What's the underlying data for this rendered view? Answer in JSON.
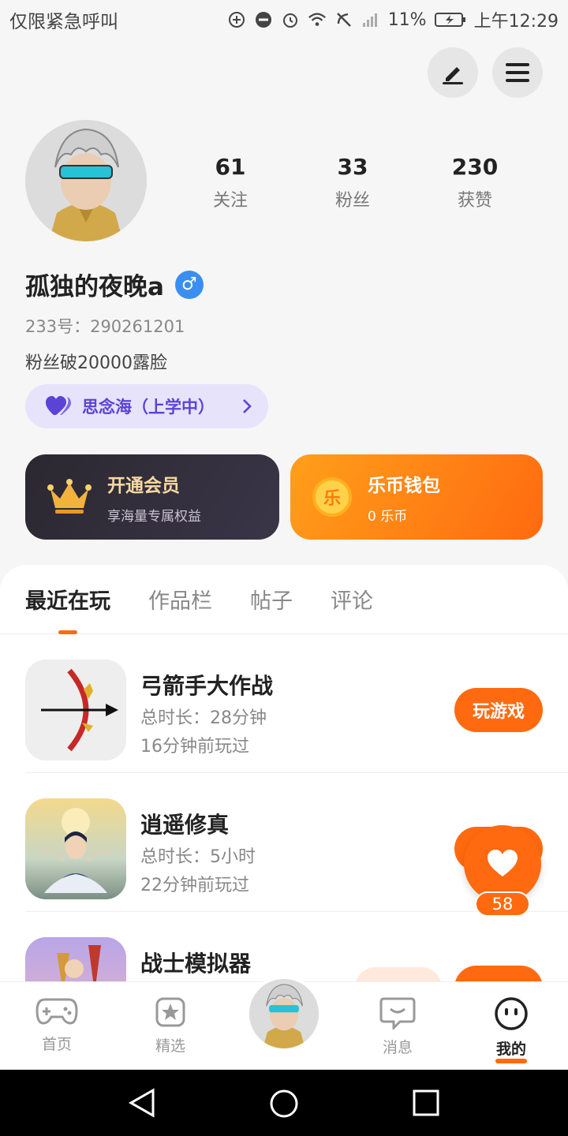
{
  "status_bar": {
    "left_text": "仅限紧急呼叫",
    "battery": "11%",
    "time": "上午12:29"
  },
  "profile": {
    "username": "孤独的夜晚a",
    "gender_symbol": "♂",
    "uid": "233号：290261201",
    "bio": "粉丝破20000露脸",
    "stats": [
      {
        "num": "61",
        "label": "关注"
      },
      {
        "num": "33",
        "label": "粉丝"
      },
      {
        "num": "230",
        "label": "获赞"
      }
    ],
    "family": "思念海（上学中）"
  },
  "cards": {
    "vip": {
      "title": "开通会员",
      "sub": "享海量专属权益",
      "icon": "crown-icon"
    },
    "wallet": {
      "title": "乐币钱包",
      "sub": "0 乐币",
      "icon_text": "乐"
    }
  },
  "tabs": [
    "最近在玩",
    "作品栏",
    "帖子",
    "评论"
  ],
  "games": [
    {
      "name": "弓箭手大作战",
      "duration": "总时长：28分钟",
      "last": "16分钟前玩过",
      "button": "玩游戏"
    },
    {
      "name": "逍遥修真",
      "duration": "总时长：5小时",
      "last": "22分钟前玩过",
      "button": ""
    },
    {
      "name": "战士模拟器",
      "duration": "",
      "last": "",
      "button": ""
    }
  ],
  "floating_like": {
    "count": "58"
  },
  "bottom_nav": [
    {
      "label": "首页",
      "icon": "gamepad-icon"
    },
    {
      "label": "精选",
      "icon": "star-icon"
    },
    {
      "label": "消息",
      "icon": "chat-icon"
    },
    {
      "label": "我的",
      "icon": "smiley-icon"
    }
  ],
  "colors": {
    "accent": "#ff6a10",
    "family_bg": "#e7e3fb",
    "family_text": "#5b43d6",
    "gender": "#3a8ef0"
  }
}
